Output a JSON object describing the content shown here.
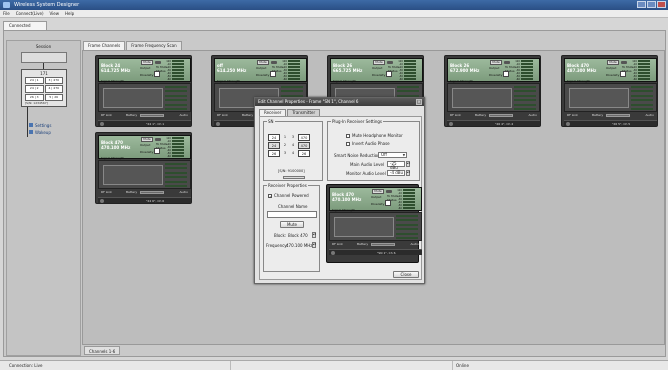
{
  "window": {
    "title": "Wireless System Designer"
  },
  "menu": [
    "File",
    "Connect(Live)",
    "View",
    "Help"
  ],
  "connected_tab": "Connected",
  "left_panel": {
    "title": "Session",
    "frame_label": "171",
    "grid": [
      "24 | 1",
      "3 | 470",
      "24 | 2",
      "4 | 470",
      "26 | 3",
      "5 | 26",
      "",
      ""
    ],
    "serial": "[S/N: 1234567]",
    "links": [
      "Settings",
      "Wakeup"
    ]
  },
  "tabs": [
    "Frame Channels",
    "Frame Frequency Scan"
  ],
  "bottom_tab": "Channels 1-6",
  "status": {
    "left": "Connection: Live",
    "right": "Online"
  },
  "cards": [
    {
      "name": "Block 24",
      "freq": "614.725 MHz",
      "footer": "\"24 1\", Ch 1"
    },
    {
      "name": "off",
      "freq": "614.250 MHz",
      "footer": "\"24 2\", Ch 2"
    },
    {
      "name": "Block 26",
      "freq": "665.725 MHz",
      "footer": "\"26 3\", Ch 3"
    },
    {
      "name": "Block 26",
      "freq": "672.900 MHz",
      "footer": "\"26 4\", Ch 4"
    },
    {
      "name": "Block 470",
      "freq": "487.300 MHz",
      "footer": "\"26 5\", Ch 5"
    },
    {
      "name": "Block 470",
      "freq": "470.100 MHz",
      "footer": "\"24 6\", Ch 6"
    }
  ],
  "card_common": {
    "mute": "Mute",
    "output": "Output",
    "to_mute": "To Mute",
    "status": "Status",
    "diversity": "Diversity",
    "signal_strength": "Signal Strength",
    "rf_link": "RF Link",
    "battery": "Battery",
    "audio": "Audio",
    "meter": [
      "120",
      "-10",
      "-20",
      "-30",
      "-40",
      "-50",
      "-60"
    ]
  },
  "dialog": {
    "title": "Edit Channel Properties - Frame \"SN 1\", Channel 6",
    "tabs": [
      "Receiver",
      "Transmitter"
    ],
    "grid_caption": "SN",
    "tx_grid": [
      {
        "a": "24",
        "b": "1",
        "c": "3",
        "d": "470"
      },
      {
        "a": "24",
        "b": "2",
        "c": "4",
        "d": "470"
      },
      {
        "a": "26",
        "b": "3",
        "c": "4",
        "d": "26"
      }
    ],
    "serial": "[S/N: 9100000]",
    "plugin": {
      "caption": "Plug-In Receiver Settings",
      "mute_headphone": "Mute Headphone Monitor",
      "invert_phase": "Invert Audio Phase",
      "smart_noise_label": "Smart Noise Reduction",
      "smart_noise_value": "Off",
      "main_audio_label": "Main Audio Level",
      "main_audio_value": "-25 dBu",
      "monitor_audio_label": "Monitor Audio Level",
      "monitor_audio_value": "-4 dBu"
    },
    "receiver": {
      "caption": "Receiver Properties",
      "channel_powered": "Channel Powered",
      "channel_name_label": "Channel Name",
      "channel_name_value": "",
      "mute": "Mute",
      "block_label": "Block:",
      "block_value": "Block 470",
      "frequency_label": "Frequency:",
      "frequency_value": "470.100 MHz"
    },
    "preview": {
      "name": "Block 470",
      "freq": "470.100 MHz",
      "footer": "\"SN 1\", Ch 6"
    },
    "close": "Close"
  }
}
